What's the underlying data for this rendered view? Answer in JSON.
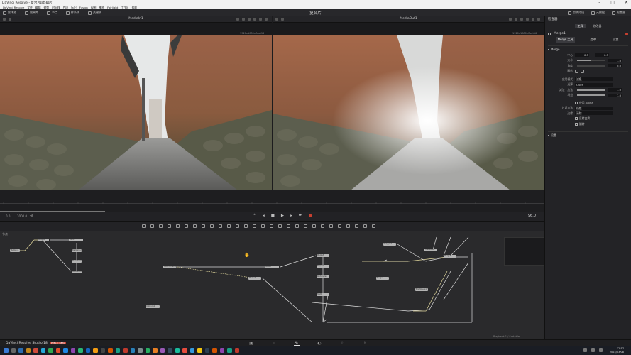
{
  "window": {
    "title": "DaVinci Resolve - 复合片段 -",
    "title_tab": "剪辑片",
    "controls": [
      "–",
      "□",
      "✕"
    ]
  },
  "menu": [
    "DaVinci Resolve",
    "文件",
    "编辑",
    "修剪",
    "时间线",
    "片段",
    "标记",
    "Fusion",
    "视图",
    "播放",
    "Fairlight",
    "工作区",
    "帮助"
  ],
  "toolbar": {
    "left": [
      {
        "icon": "media-pool-icon",
        "label": "媒体池"
      },
      {
        "icon": "effects-icon",
        "label": "效果库"
      },
      {
        "icon": "nodes-icon",
        "label": "节点"
      },
      {
        "icon": "spline-icon",
        "label": "样条线"
      },
      {
        "icon": "keyframes-icon",
        "label": "关键帧"
      },
      {
        "icon": "metadata-icon",
        "label": "元数据"
      }
    ],
    "center_title": "复合片",
    "right": [
      {
        "icon": "clip-icon",
        "label": "剪辑片段"
      },
      {
        "icon": "metadata-icon",
        "label": "元数据"
      },
      {
        "icon": "inspector-icon",
        "label": "检查器"
      }
    ]
  },
  "viewers": {
    "left": {
      "title": "MediaIn1",
      "resolution": "1920x1080xfloat16"
    },
    "right": {
      "title": "MediaOut1",
      "resolution": "1920x1080xfloat16"
    }
  },
  "transport": {
    "in": "0.0",
    "out": "1000.0",
    "frame": "96.0"
  },
  "inspector": {
    "title": "检查器",
    "tab_tools": "工具",
    "tab_modifiers": "修改器",
    "node_name": "Merge1",
    "tabs": [
      "Merge 工具",
      "遮罩",
      "设置"
    ],
    "section": "Merge",
    "properties": [
      {
        "label": "中心",
        "x": "0.5",
        "y": "0.5"
      },
      {
        "label": "大小",
        "value": "1.0",
        "fill": 0.5
      },
      {
        "label": "角度",
        "value": "0.0",
        "fill": 0.0
      },
      {
        "label": "翻转",
        "value": ""
      }
    ],
    "apply_mode_label": "应用模式",
    "apply_mode": "滤色",
    "operator_label": "运算",
    "operator": "Over",
    "subtractive_label": "减法 - 加法",
    "subtractive": "1.0",
    "gain_label": "增益",
    "gain": "1.0",
    "blend_label": "混合",
    "blend": "1.0",
    "filter_label": "过滤方法",
    "filter": "线性",
    "edges_label": "边缘",
    "edges": "清除",
    "checks": [
      "使用 Alpha",
      "反转变换",
      "翻转"
    ],
    "reference_label": "参考大小",
    "settings_section": "设置"
  },
  "nodes": [
    {
      "id": "MediaIn1",
      "label": "MediaIn1"
    },
    {
      "id": "Merge1",
      "label": "Merge1"
    },
    {
      "id": "Blur1",
      "label": "Blur1"
    },
    {
      "id": "Background1",
      "label": "Background1"
    },
    {
      "id": "Transform1",
      "label": "Transform1"
    },
    {
      "id": "MediaOut1",
      "label": "MediaOut1"
    },
    {
      "id": "ColorCorrector1",
      "label": "ColorCorrector1"
    },
    {
      "id": "Glow1",
      "label": "Glow1"
    },
    {
      "id": "Merge2",
      "label": "Merge2"
    },
    {
      "id": "Merge3",
      "label": "Merge3"
    },
    {
      "id": "Ellipse1",
      "label": "Ellipse1"
    },
    {
      "id": "Rectangle1",
      "label": "Rectangle1"
    },
    {
      "id": "Text1",
      "label": "Text1"
    },
    {
      "id": "Polygon1",
      "label": "Polygon1"
    },
    {
      "id": "Merge4",
      "label": "Merge4"
    },
    {
      "id": "FastNoise1",
      "label": "FastNoise1"
    },
    {
      "id": "Merge5",
      "label": "Merge5"
    },
    {
      "id": "Brightness1",
      "label": "Brightness1"
    },
    {
      "id": "Instance1",
      "label": "Instance1"
    }
  ],
  "node_editor_label": "节点",
  "status_right": "Playback 1 / Sortable",
  "pagebar": {
    "brand": "DaVinci Resolve Studio 18",
    "badge": "PUBLIC BETA",
    "pages": [
      "▣",
      "⧉",
      "✎",
      "◐",
      "♪",
      "⇪"
    ]
  },
  "taskbar": {
    "time": "12:57",
    "date": "2024/03/08"
  },
  "colors": {
    "accent": "#c84030",
    "node": "#b4b4b4",
    "connection_yellow": "#e6dca0",
    "connection_white": "#dddddd"
  }
}
